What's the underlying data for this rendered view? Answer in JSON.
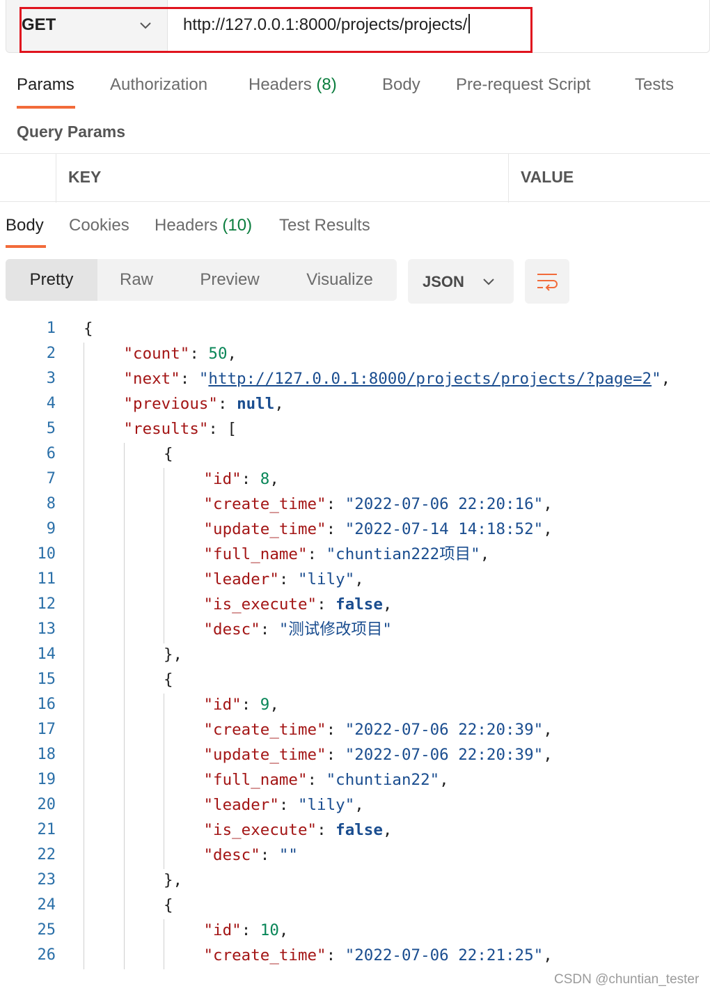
{
  "request": {
    "method": "GET",
    "url": "http://127.0.0.1:8000/projects/projects/"
  },
  "request_tabs": {
    "params": "Params",
    "authorization": "Authorization",
    "headers": "Headers",
    "headers_count": "(8)",
    "body": "Body",
    "pre_request_script": "Pre-request Script",
    "tests": "Tests"
  },
  "query_params": {
    "title": "Query Params",
    "key_header": "KEY",
    "value_header": "VALUE"
  },
  "response_tabs": {
    "body": "Body",
    "cookies": "Cookies",
    "headers": "Headers",
    "headers_count": "(10)",
    "test_results": "Test Results"
  },
  "view_modes": [
    "Pretty",
    "Raw",
    "Preview",
    "Visualize"
  ],
  "format": "JSON",
  "icons": {
    "method_dropdown": "chevron-down-icon",
    "format_dropdown": "chevron-down-icon",
    "wrap": "wrap-lines-icon"
  },
  "colors": {
    "accent": "#f26b3a",
    "highlight_box": "#e0141e",
    "json_key": "#a31515",
    "json_string": "#1a4d8f",
    "json_number": "#098658"
  },
  "code_lines": [
    {
      "no": "1",
      "indent": 0,
      "tokens": [
        {
          "t": "{",
          "c": "p"
        }
      ]
    },
    {
      "no": "2",
      "indent": 1,
      "tokens": [
        {
          "t": "\"count\"",
          "c": "key"
        },
        {
          "t": ": ",
          "c": "p"
        },
        {
          "t": "50",
          "c": "num"
        },
        {
          "t": ",",
          "c": "p"
        }
      ]
    },
    {
      "no": "3",
      "indent": 1,
      "tokens": [
        {
          "t": "\"next\"",
          "c": "key"
        },
        {
          "t": ": ",
          "c": "p"
        },
        {
          "t": "\"",
          "c": "str"
        },
        {
          "t": "http://127.0.0.1:8000/projects/projects/?page=2",
          "c": "link"
        },
        {
          "t": "\"",
          "c": "str"
        },
        {
          "t": ",",
          "c": "p"
        }
      ]
    },
    {
      "no": "4",
      "indent": 1,
      "tokens": [
        {
          "t": "\"previous\"",
          "c": "key"
        },
        {
          "t": ": ",
          "c": "p"
        },
        {
          "t": "null",
          "c": "kw"
        },
        {
          "t": ",",
          "c": "p"
        }
      ]
    },
    {
      "no": "5",
      "indent": 1,
      "tokens": [
        {
          "t": "\"results\"",
          "c": "key"
        },
        {
          "t": ": [",
          "c": "p"
        }
      ]
    },
    {
      "no": "6",
      "indent": 2,
      "tokens": [
        {
          "t": "{",
          "c": "p"
        }
      ]
    },
    {
      "no": "7",
      "indent": 3,
      "tokens": [
        {
          "t": "\"id\"",
          "c": "key"
        },
        {
          "t": ": ",
          "c": "p"
        },
        {
          "t": "8",
          "c": "num"
        },
        {
          "t": ",",
          "c": "p"
        }
      ]
    },
    {
      "no": "8",
      "indent": 3,
      "tokens": [
        {
          "t": "\"create_time\"",
          "c": "key"
        },
        {
          "t": ": ",
          "c": "p"
        },
        {
          "t": "\"2022-07-06 22:20:16\"",
          "c": "str"
        },
        {
          "t": ",",
          "c": "p"
        }
      ]
    },
    {
      "no": "9",
      "indent": 3,
      "tokens": [
        {
          "t": "\"update_time\"",
          "c": "key"
        },
        {
          "t": ": ",
          "c": "p"
        },
        {
          "t": "\"2022-07-14 14:18:52\"",
          "c": "str"
        },
        {
          "t": ",",
          "c": "p"
        }
      ]
    },
    {
      "no": "10",
      "indent": 3,
      "tokens": [
        {
          "t": "\"full_name\"",
          "c": "key"
        },
        {
          "t": ": ",
          "c": "p"
        },
        {
          "t": "\"chuntian222项目\"",
          "c": "str"
        },
        {
          "t": ",",
          "c": "p"
        }
      ]
    },
    {
      "no": "11",
      "indent": 3,
      "tokens": [
        {
          "t": "\"leader\"",
          "c": "key"
        },
        {
          "t": ": ",
          "c": "p"
        },
        {
          "t": "\"lily\"",
          "c": "str"
        },
        {
          "t": ",",
          "c": "p"
        }
      ]
    },
    {
      "no": "12",
      "indent": 3,
      "tokens": [
        {
          "t": "\"is_execute\"",
          "c": "key"
        },
        {
          "t": ": ",
          "c": "p"
        },
        {
          "t": "false",
          "c": "kw"
        },
        {
          "t": ",",
          "c": "p"
        }
      ]
    },
    {
      "no": "13",
      "indent": 3,
      "tokens": [
        {
          "t": "\"desc\"",
          "c": "key"
        },
        {
          "t": ": ",
          "c": "p"
        },
        {
          "t": "\"测试修改项目\"",
          "c": "str"
        }
      ]
    },
    {
      "no": "14",
      "indent": 2,
      "tokens": [
        {
          "t": "},",
          "c": "p"
        }
      ]
    },
    {
      "no": "15",
      "indent": 2,
      "tokens": [
        {
          "t": "{",
          "c": "p"
        }
      ]
    },
    {
      "no": "16",
      "indent": 3,
      "tokens": [
        {
          "t": "\"id\"",
          "c": "key"
        },
        {
          "t": ": ",
          "c": "p"
        },
        {
          "t": "9",
          "c": "num"
        },
        {
          "t": ",",
          "c": "p"
        }
      ]
    },
    {
      "no": "17",
      "indent": 3,
      "tokens": [
        {
          "t": "\"create_time\"",
          "c": "key"
        },
        {
          "t": ": ",
          "c": "p"
        },
        {
          "t": "\"2022-07-06 22:20:39\"",
          "c": "str"
        },
        {
          "t": ",",
          "c": "p"
        }
      ]
    },
    {
      "no": "18",
      "indent": 3,
      "tokens": [
        {
          "t": "\"update_time\"",
          "c": "key"
        },
        {
          "t": ": ",
          "c": "p"
        },
        {
          "t": "\"2022-07-06 22:20:39\"",
          "c": "str"
        },
        {
          "t": ",",
          "c": "p"
        }
      ]
    },
    {
      "no": "19",
      "indent": 3,
      "tokens": [
        {
          "t": "\"full_name\"",
          "c": "key"
        },
        {
          "t": ": ",
          "c": "p"
        },
        {
          "t": "\"chuntian22\"",
          "c": "str"
        },
        {
          "t": ",",
          "c": "p"
        }
      ]
    },
    {
      "no": "20",
      "indent": 3,
      "tokens": [
        {
          "t": "\"leader\"",
          "c": "key"
        },
        {
          "t": ": ",
          "c": "p"
        },
        {
          "t": "\"lily\"",
          "c": "str"
        },
        {
          "t": ",",
          "c": "p"
        }
      ]
    },
    {
      "no": "21",
      "indent": 3,
      "tokens": [
        {
          "t": "\"is_execute\"",
          "c": "key"
        },
        {
          "t": ": ",
          "c": "p"
        },
        {
          "t": "false",
          "c": "kw"
        },
        {
          "t": ",",
          "c": "p"
        }
      ]
    },
    {
      "no": "22",
      "indent": 3,
      "tokens": [
        {
          "t": "\"desc\"",
          "c": "key"
        },
        {
          "t": ": ",
          "c": "p"
        },
        {
          "t": "\"\"",
          "c": "str"
        }
      ]
    },
    {
      "no": "23",
      "indent": 2,
      "tokens": [
        {
          "t": "},",
          "c": "p"
        }
      ]
    },
    {
      "no": "24",
      "indent": 2,
      "tokens": [
        {
          "t": "{",
          "c": "p"
        }
      ]
    },
    {
      "no": "25",
      "indent": 3,
      "tokens": [
        {
          "t": "\"id\"",
          "c": "key"
        },
        {
          "t": ": ",
          "c": "p"
        },
        {
          "t": "10",
          "c": "num"
        },
        {
          "t": ",",
          "c": "p"
        }
      ]
    },
    {
      "no": "26",
      "indent": 3,
      "tokens": [
        {
          "t": "\"create_time\"",
          "c": "key"
        },
        {
          "t": ": ",
          "c": "p"
        },
        {
          "t": "\"2022-07-06 22:21:25\"",
          "c": "str"
        },
        {
          "t": ",",
          "c": "p"
        }
      ]
    }
  ],
  "watermark": "CSDN @chuntian_tester"
}
